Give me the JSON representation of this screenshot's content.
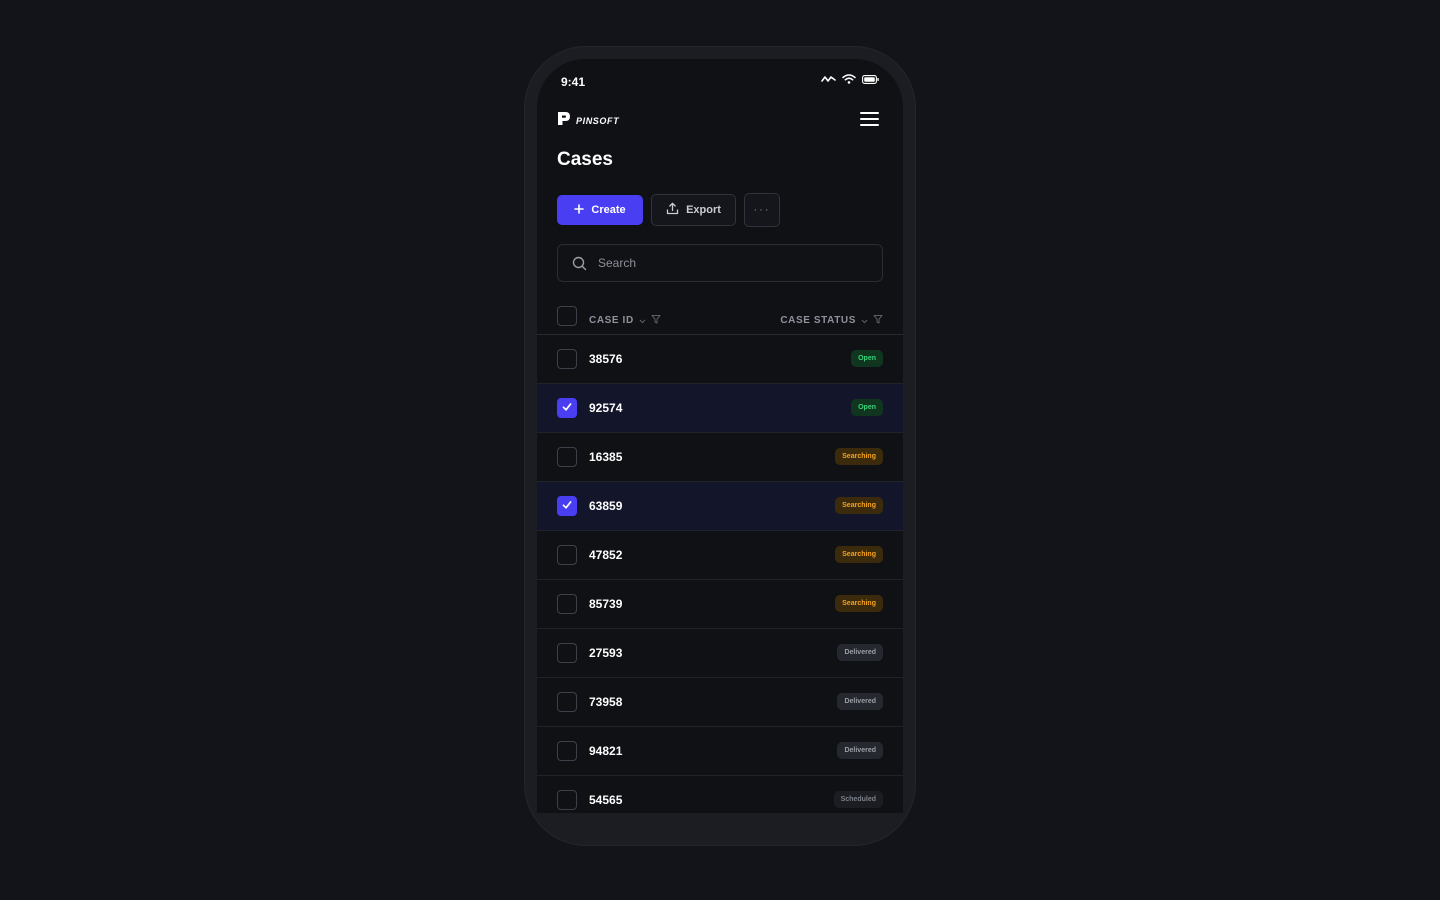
{
  "status_bar": {
    "time": "9:41",
    "icons": [
      "signal-icon",
      "wifi-icon",
      "battery-icon"
    ]
  },
  "header": {
    "brand": "PINSOFT",
    "logo_icon": "pinsoft-logo-icon",
    "menu_icon": "hamburger-menu-icon"
  },
  "page": {
    "title": "Cases"
  },
  "toolbar": {
    "create_label": "Create",
    "create_icon": "plus-icon",
    "export_label": "Export",
    "export_icon": "upload-icon",
    "more_label": "···",
    "more_icon": "ellipsis-icon"
  },
  "search": {
    "placeholder": "Search",
    "value": "",
    "icon": "search-icon"
  },
  "table": {
    "columns": [
      "CASE ID",
      "CASE STATUS"
    ],
    "rows": [
      {
        "id": "38576",
        "status": "Open",
        "status_type": "open",
        "selected": false
      },
      {
        "id": "92574",
        "status": "Open",
        "status_type": "open",
        "selected": true
      },
      {
        "id": "16385",
        "status": "Searching",
        "status_type": "searching",
        "selected": false
      },
      {
        "id": "63859",
        "status": "Searching",
        "status_type": "searching",
        "selected": true
      },
      {
        "id": "47852",
        "status": "Searching",
        "status_type": "searching",
        "selected": false
      },
      {
        "id": "85739",
        "status": "Searching",
        "status_type": "searching",
        "selected": false
      },
      {
        "id": "27593",
        "status": "Delivered",
        "status_type": "delivered",
        "selected": false
      },
      {
        "id": "73958",
        "status": "Delivered",
        "status_type": "delivered",
        "selected": false
      },
      {
        "id": "94821",
        "status": "Delivered",
        "status_type": "delivered",
        "selected": false
      },
      {
        "id": "54565",
        "status": "Scheduled",
        "status_type": "scheduled",
        "selected": false
      }
    ]
  },
  "colors": {
    "background": "#121419",
    "screen": "#0f1115",
    "accent": "#4a3ef2",
    "open": "#3ad47a",
    "searching": "#f3a31f",
    "delivered": "#9a9ea6"
  }
}
